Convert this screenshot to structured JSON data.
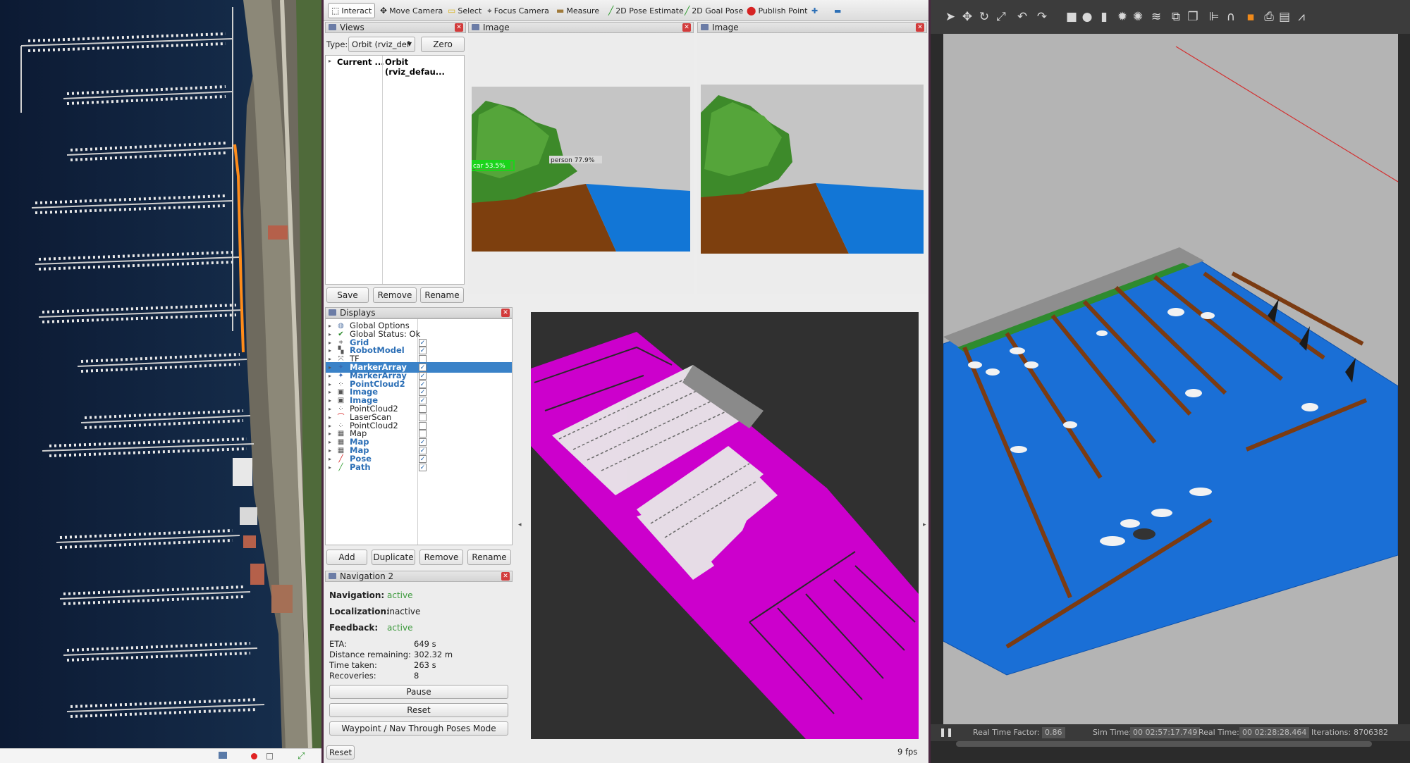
{
  "rviz": {
    "toolbar": {
      "interact": "Interact",
      "move_camera": "Move Camera",
      "select": "Select",
      "focus_camera": "Focus Camera",
      "measure": "Measure",
      "pose_estimate": "2D Pose Estimate",
      "goal_pose": "2D Goal Pose",
      "publish_point": "Publish Point"
    },
    "views": {
      "title": "Views",
      "type_label": "Type:",
      "type_value": "Orbit (rviz_def",
      "zero_button": "Zero",
      "col1": "Current ...",
      "col2": "Orbit (rviz_defau...",
      "save": "Save",
      "remove": "Remove",
      "rename": "Rename"
    },
    "image_panels": [
      {
        "title": "Image",
        "detections": [
          {
            "label": "car 53.5%"
          },
          {
            "label": "person 77.9%"
          }
        ]
      },
      {
        "title": "Image"
      }
    ],
    "displays": {
      "title": "Displays",
      "items": [
        {
          "label": "Global Options",
          "icon": "globe-icon",
          "enabled": null,
          "highlight": false
        },
        {
          "label": "Global Status: Ok",
          "icon": "check-icon",
          "enabled": null,
          "highlight": false
        },
        {
          "label": "Grid",
          "icon": "grid-icon",
          "enabled": true,
          "highlight": true
        },
        {
          "label": "RobotModel",
          "icon": "robot-model-icon",
          "enabled": true,
          "highlight": true
        },
        {
          "label": "TF",
          "icon": "tf-icon",
          "enabled": false,
          "highlight": false
        },
        {
          "label": "MarkerArray",
          "icon": "marker-array-icon",
          "enabled": true,
          "highlight": true,
          "selected": true
        },
        {
          "label": "MarkerArray",
          "icon": "marker-array-icon",
          "enabled": true,
          "highlight": true
        },
        {
          "label": "PointCloud2",
          "icon": "pointcloud-icon",
          "enabled": true,
          "highlight": true
        },
        {
          "label": "Image",
          "icon": "image-icon",
          "enabled": true,
          "highlight": true
        },
        {
          "label": "Image",
          "icon": "image-icon",
          "enabled": true,
          "highlight": true
        },
        {
          "label": "PointCloud2",
          "icon": "pointcloud-icon",
          "enabled": false,
          "highlight": false
        },
        {
          "label": "LaserScan",
          "icon": "laserscan-icon",
          "enabled": false,
          "highlight": false
        },
        {
          "label": "PointCloud2",
          "icon": "pointcloud-icon",
          "enabled": false,
          "highlight": false
        },
        {
          "label": "Map",
          "icon": "map-icon",
          "enabled": false,
          "highlight": false
        },
        {
          "label": "Map",
          "icon": "map-icon",
          "enabled": true,
          "highlight": true
        },
        {
          "label": "Map",
          "icon": "map-icon",
          "enabled": true,
          "highlight": true
        },
        {
          "label": "Pose",
          "icon": "pose-icon",
          "enabled": true,
          "highlight": true
        },
        {
          "label": "Path",
          "icon": "path-icon",
          "enabled": true,
          "highlight": true
        }
      ],
      "add": "Add",
      "duplicate": "Duplicate",
      "remove": "Remove",
      "rename": "Rename"
    },
    "navigation": {
      "title": "Navigation 2",
      "navigation_label": "Navigation:",
      "navigation_value": "active",
      "localization_label": "Localization:",
      "localization_value": "inactive",
      "feedback_label": "Feedback:",
      "feedback_value": "active",
      "eta_label": "ETA:",
      "eta_value": "649 s",
      "distance_label": "Distance remaining:",
      "distance_value": "302.32 m",
      "time_label": "Time taken:",
      "time_value": "263 s",
      "recoveries_label": "Recoveries:",
      "recoveries_value": "8",
      "pause": "Pause",
      "reset": "Reset",
      "waypoint_mode": "Waypoint / Nav Through Poses Mode"
    },
    "statusbar": {
      "reset": "Reset",
      "fps": "9 fps"
    },
    "colors": {
      "active": "#3d9a3d",
      "highlight": "#2c6fb6",
      "map_magenta": "#cc00cc"
    }
  },
  "gazebo": {
    "status": {
      "rtf_label": "Real Time Factor:",
      "rtf_value": "0.86",
      "sim_label": "Sim Time:",
      "sim_value": "00 02:57:17.749",
      "real_label": "Real Time:",
      "real_value": "00 02:28:28.464",
      "iter_label": "Iterations:",
      "iter_value": "8706382"
    },
    "toolbar_icons": [
      "select-arrow-icon",
      "translate-icon",
      "rotate-icon",
      "scale-icon",
      "undo-icon",
      "redo-icon",
      "box-icon",
      "sphere-icon",
      "cylinder-icon",
      "sun-light-icon",
      "spot-light-icon",
      "directional-light-icon",
      "copy-icon",
      "paste-icon",
      "align-icon",
      "snap-icon",
      "orange-select-icon",
      "screenshot-icon",
      "log-icon",
      "plot-icon"
    ]
  }
}
